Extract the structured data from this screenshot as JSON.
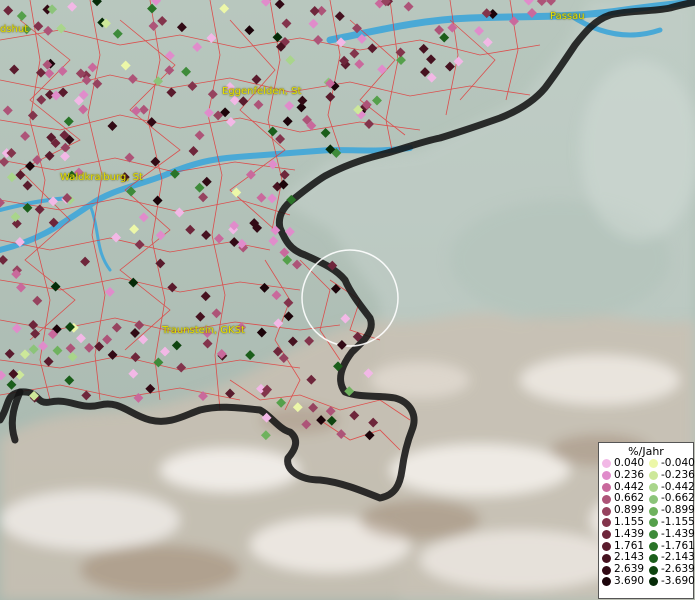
{
  "places": {
    "landshut": "dshut",
    "eggenfelden": "Eggenfelden, St",
    "waldkraiburg": "Waldkraiburg, St",
    "traunstein": "Traunstein, GKSt",
    "passau": "Passau"
  },
  "legend": {
    "title": "%/Jahr",
    "rows": [
      {
        "pos": "0.040",
        "pos_color": "#f2b8e6",
        "neg": "-0.040",
        "neg_color": "#ecf7a8"
      },
      {
        "pos": "0.236",
        "pos_color": "#e08ccb",
        "neg": "-0.236",
        "neg_color": "#cde89a"
      },
      {
        "pos": "0.442",
        "pos_color": "#c9699c",
        "neg": "-0.442",
        "neg_color": "#a9d58b"
      },
      {
        "pos": "0.662",
        "pos_color": "#ad5478",
        "neg": "-0.662",
        "neg_color": "#8cc47a"
      },
      {
        "pos": "0.899",
        "pos_color": "#96435f",
        "neg": "-0.899",
        "neg_color": "#6fb25e"
      },
      {
        "pos": "1.155",
        "pos_color": "#83344c",
        "neg": "-1.155",
        "neg_color": "#55a04b"
      },
      {
        "pos": "1.439",
        "pos_color": "#6e263b",
        "neg": "-1.439",
        "neg_color": "#3e8b3a"
      },
      {
        "pos": "1.761",
        "pos_color": "#5a1b2d",
        "neg": "-1.761",
        "neg_color": "#2a7428"
      },
      {
        "pos": "2.143",
        "pos_color": "#461220",
        "neg": "-2.143",
        "neg_color": "#1b5e1b"
      },
      {
        "pos": "2.639",
        "pos_color": "#320a15",
        "neg": "-2.639",
        "neg_color": "#0f4510"
      },
      {
        "pos": "3.690",
        "pos_color": "#1c040a",
        "neg": "-3.690",
        "neg_color": "#062b08"
      }
    ]
  },
  "colors": {
    "border": "#151515",
    "river": "#4aa9d6",
    "district_lines": "#e23a3a",
    "place_label": "#e8e000",
    "focus_circle": "#ffffff"
  }
}
